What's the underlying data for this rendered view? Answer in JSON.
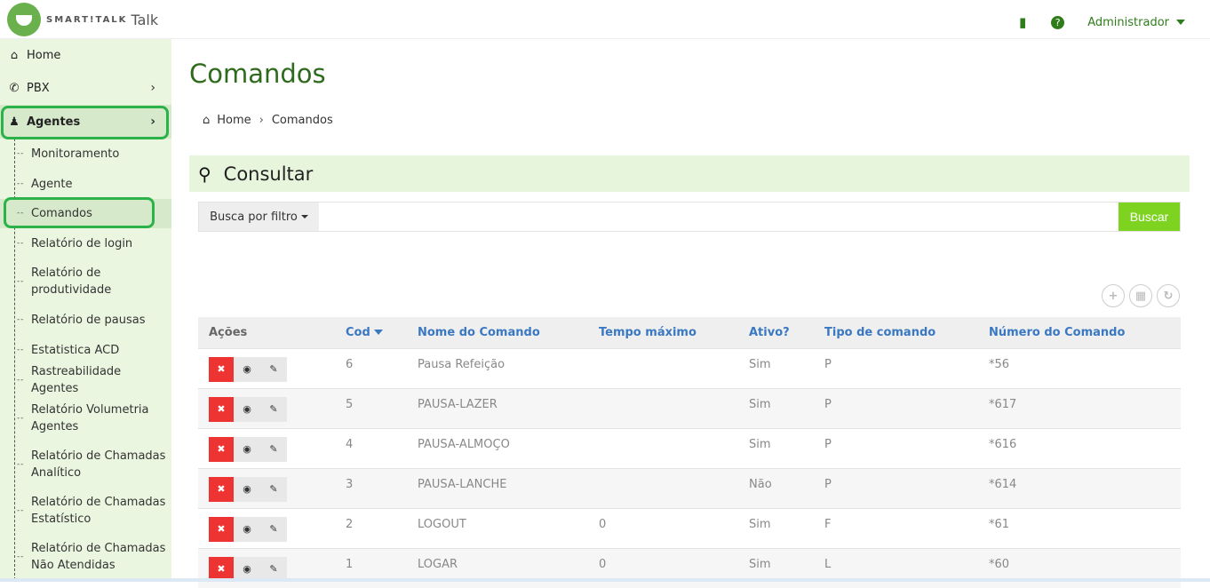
{
  "brand": {
    "name": "SMART!TALK",
    "suffix": "Talk"
  },
  "topbar": {
    "book_icon": "book-icon",
    "help_icon": "help-icon",
    "help_glyph": "?",
    "user": "Administrador"
  },
  "sidebar": {
    "items": [
      {
        "label": "Home",
        "icon": "home-icon"
      },
      {
        "label": "PBX",
        "icon": "phone-icon"
      },
      {
        "label": "Agentes",
        "icon": "person-icon"
      }
    ],
    "sub_items": [
      {
        "label": "Monitoramento"
      },
      {
        "label": "Agente"
      },
      {
        "label": "Comandos"
      },
      {
        "label": "Relatório de login"
      },
      {
        "label_1": "Relatório de",
        "label_2": "produtividade"
      },
      {
        "label": "Relatório de pausas"
      },
      {
        "label": "Estatistica ACD"
      },
      {
        "label": "Rastreabilidade Agentes"
      },
      {
        "label_1": "Relatório Volumetria",
        "label_2": "Agentes"
      },
      {
        "label_1": "Relatório de Chamadas",
        "label_2": "Analítico"
      },
      {
        "label_1": "Relatório de Chamadas",
        "label_2": "Estatístico"
      },
      {
        "label_1": "Relatório de Chamadas",
        "label_2": "Não Atendidas"
      }
    ]
  },
  "main": {
    "title": "Comandos",
    "breadcrumb": {
      "home": "Home",
      "current": "Comandos"
    },
    "panel_title": "Consultar",
    "filter": {
      "button": "Busca por filtro",
      "value": "",
      "submit": "Buscar"
    },
    "table": {
      "headers": [
        "Ações",
        "Cod",
        "Nome do Comando",
        "Tempo máximo",
        "Ativo?",
        "Tipo de comando",
        "Número do Comando"
      ],
      "rows": [
        {
          "cod": "6",
          "nome": "Pausa Refeição",
          "tempo": "",
          "ativo": "Sim",
          "tipo": "P",
          "numero": "*56"
        },
        {
          "cod": "5",
          "nome": "PAUSA-LAZER",
          "tempo": "",
          "ativo": "Sim",
          "tipo": "P",
          "numero": "*617"
        },
        {
          "cod": "4",
          "nome": "PAUSA-ALMOÇO",
          "tempo": "",
          "ativo": "Sim",
          "tipo": "P",
          "numero": "*616"
        },
        {
          "cod": "3",
          "nome": "PAUSA-LANCHE",
          "tempo": "",
          "ativo": "Não",
          "tipo": "P",
          "numero": "*614"
        },
        {
          "cod": "2",
          "nome": "LOGOUT",
          "tempo": "0",
          "ativo": "Sim",
          "tipo": "F",
          "numero": "*61"
        },
        {
          "cod": "1",
          "nome": "LOGAR",
          "tempo": "0",
          "ativo": "Sim",
          "tipo": "L",
          "numero": "*60"
        }
      ]
    }
  },
  "colors": {
    "brand_green": "#2e7d1a",
    "sidebar_bg": "#eaf6e0",
    "highlight_ring": "#2bb34a",
    "delete_red": "#ee3333",
    "buscar_green": "#7ed321",
    "header_link": "#3a78c2"
  }
}
